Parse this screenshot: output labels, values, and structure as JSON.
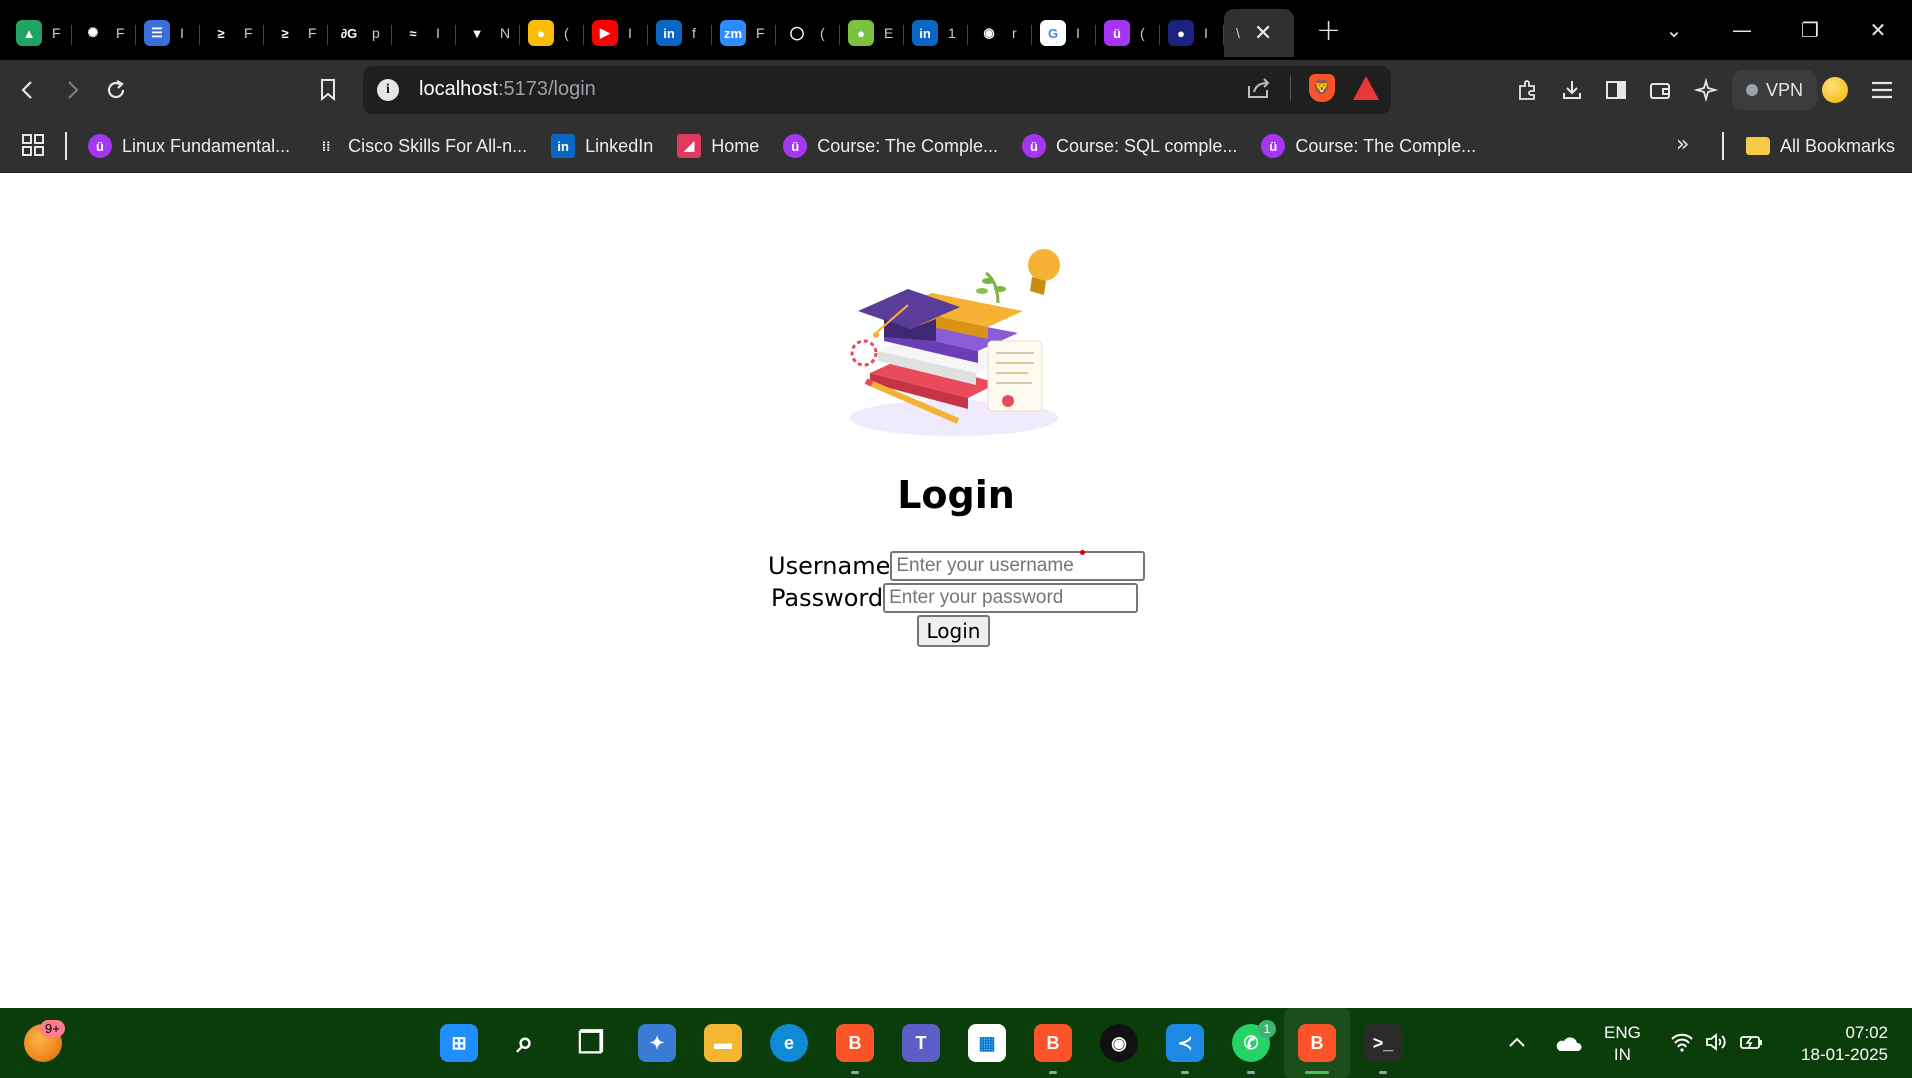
{
  "browser": {
    "tabs": [
      {
        "icon": "google-drive-icon",
        "color": "#1fa463",
        "glyph": "▲",
        "label": "F"
      },
      {
        "icon": "openai-icon",
        "color": "#000000",
        "glyph": "✺",
        "label": "F"
      },
      {
        "icon": "stack-icon",
        "color": "#3b6fd8",
        "glyph": "☰",
        "label": "I"
      },
      {
        "icon": "sololearn-icon",
        "color": "#000000",
        "glyph": "≥",
        "label": "F"
      },
      {
        "icon": "sololearn-icon",
        "color": "#000000",
        "glyph": "≥",
        "label": "F"
      },
      {
        "icon": "geeksforgeeks-icon",
        "color": "#000000",
        "glyph": "∂G",
        "label": "p"
      },
      {
        "icon": "tailwind-icon",
        "color": "#000000",
        "glyph": "≈",
        "label": "I"
      },
      {
        "icon": "vectorized-icon",
        "color": "#000000",
        "glyph": "▼",
        "label": "N"
      },
      {
        "icon": "google-keep-icon",
        "color": "#fbbc04",
        "glyph": "●",
        "label": "("
      },
      {
        "icon": "youtube-icon",
        "color": "#ff0000",
        "glyph": "▶",
        "label": "I"
      },
      {
        "icon": "linkedin-icon",
        "color": "#0a66c2",
        "glyph": "in",
        "label": "f"
      },
      {
        "icon": "zoom-icon",
        "color": "#2d8cff",
        "glyph": "zm",
        "label": "F"
      },
      {
        "icon": "opencollective-icon",
        "color": "#000000",
        "glyph": "◯",
        "label": "("
      },
      {
        "icon": "green-avatar-icon",
        "color": "#7cc242",
        "glyph": "●",
        "label": "E"
      },
      {
        "icon": "linkedin-icon",
        "color": "#0a66c2",
        "glyph": "in",
        "label": "1"
      },
      {
        "icon": "github-icon",
        "color": "#000000",
        "glyph": "◉",
        "label": "r"
      },
      {
        "icon": "google-icon",
        "color": "#ffffff",
        "glyph": "G",
        "label": "I"
      },
      {
        "icon": "udemy-icon",
        "color": "#a435f0",
        "glyph": "ü",
        "label": "("
      },
      {
        "icon": "globe-icon",
        "color": "#1a237e",
        "glyph": "●",
        "label": "I"
      }
    ],
    "active_tab": {
      "label": "\\"
    },
    "window_controls": {
      "list": "⌄",
      "minimize": "—",
      "restore": "❐",
      "close": "✕"
    },
    "url_host": "localhost",
    "url_path": ":5173/login",
    "vpn_label": "VPN",
    "bookmarks": [
      {
        "label": "Linux Fundamental...",
        "icon": "udemy-icon",
        "color": "#a435f0",
        "glyph": "ü"
      },
      {
        "label": "Cisco Skills For All-n...",
        "icon": "cisco-icon",
        "color": "#303030",
        "glyph": "⁞⁞"
      },
      {
        "label": "LinkedIn",
        "icon": "linkedin-icon",
        "color": "#0a66c2",
        "glyph": "in"
      },
      {
        "label": "Home",
        "icon": "home-icon",
        "color": "#e03a5c",
        "glyph": "◢"
      },
      {
        "label": "Course: The Comple...",
        "icon": "udemy-icon",
        "color": "#a435f0",
        "glyph": "ü"
      },
      {
        "label": "Course: SQL comple...",
        "icon": "udemy-icon",
        "color": "#a435f0",
        "glyph": "ü"
      },
      {
        "label": "Course: The Comple...",
        "icon": "udemy-icon",
        "color": "#a435f0",
        "glyph": "ü"
      }
    ],
    "bookmarks_more": "»",
    "all_bookmarks": "All Bookmarks"
  },
  "page": {
    "title": "Login",
    "username_label": "Username",
    "username_placeholder": "Enter your username",
    "password_label": "Password",
    "password_placeholder": "Enter your password",
    "login_button": "Login"
  },
  "taskbar": {
    "weather_badge": "9+",
    "apps": [
      {
        "name": "start-icon",
        "color": "#1f8fff",
        "glyph": "⊞"
      },
      {
        "name": "search-icon",
        "color": "transparent",
        "glyph": "⌕"
      },
      {
        "name": "task-view-icon",
        "color": "transparent",
        "glyph": "❐"
      },
      {
        "name": "copilot-icon",
        "color": "#3a7bd5",
        "glyph": "✦"
      },
      {
        "name": "file-explorer-icon",
        "color": "#f2b632",
        "glyph": "▬"
      },
      {
        "name": "edge-icon",
        "color": "#0f8ad6",
        "glyph": "e"
      },
      {
        "name": "brave-beta-icon",
        "color": "#fb542b",
        "glyph": "B"
      },
      {
        "name": "teams-icon",
        "color": "#5b5fc7",
        "glyph": "T"
      },
      {
        "name": "store-icon",
        "color": "#ffffff",
        "glyph": "▦"
      },
      {
        "name": "brave-nightly-icon",
        "color": "#fb542b",
        "glyph": "B"
      },
      {
        "name": "github-desktop-icon",
        "color": "#111111",
        "glyph": "◉"
      },
      {
        "name": "vscode-icon",
        "color": "#1e88e5",
        "glyph": "≺"
      },
      {
        "name": "whatsapp-icon",
        "color": "#25d366",
        "glyph": "✆"
      },
      {
        "name": "brave-icon",
        "color": "#fb542b",
        "glyph": "B"
      },
      {
        "name": "terminal-icon",
        "color": "#2b2b2b",
        "glyph": ">_"
      }
    ],
    "whatsapp_badge": "1",
    "lang_line1": "ENG",
    "lang_line2": "IN",
    "time": "07:02",
    "date": "18-01-2025"
  }
}
